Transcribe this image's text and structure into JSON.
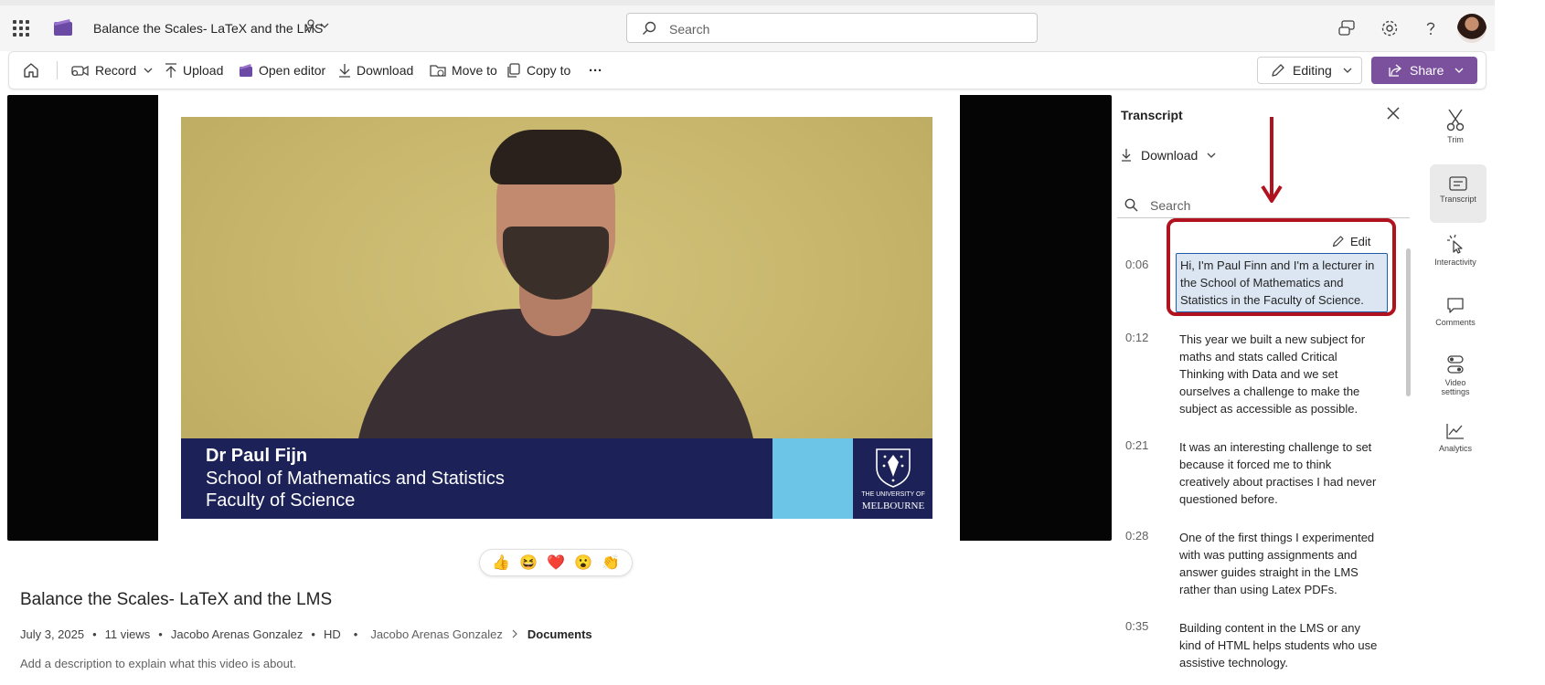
{
  "header": {
    "doc_title": "Balance the Scales- LaTeX and the LMS",
    "search_placeholder": "Search"
  },
  "toolbar": {
    "record": "Record",
    "upload": "Upload",
    "open_editor": "Open editor",
    "download": "Download",
    "move_to": "Move to",
    "copy_to": "Copy to",
    "more": "···",
    "editing": "Editing",
    "share": "Share"
  },
  "video": {
    "lower_third": {
      "name": "Dr Paul Fijn",
      "line2": "School of Mathematics and Statistics",
      "line3": "Faculty of Science",
      "logo_small": "THE UNIVERSITY OF",
      "logo_big": "MELBOURNE"
    },
    "reactions": [
      "👍",
      "😆",
      "❤️",
      "😮",
      "👏"
    ]
  },
  "details": {
    "title": "Balance the Scales- LaTeX and the LMS",
    "date": "July 3, 2025",
    "views": "11 views",
    "owner": "Jacobo Arenas Gonzalez",
    "quality": "HD",
    "path_owner": "Jacobo Arenas Gonzalez",
    "path_folder": "Documents",
    "description_placeholder": "Add a description to explain what this video is about."
  },
  "transcript": {
    "title": "Transcript",
    "download": "Download",
    "search_placeholder": "Search",
    "edit": "Edit",
    "entries": [
      {
        "time": "0:06",
        "text": "Hi, I'm Paul Finn and I'm a lecturer in the School of Mathematics and Statistics in the Faculty of Science."
      },
      {
        "time": "0:12",
        "text": "This year we built a new subject for maths and stats called Critical Thinking with Data and we set ourselves a challenge to make the subject as accessible as possible."
      },
      {
        "time": "0:21",
        "text": "It was an interesting challenge to set because it forced me to think creatively about practises I had never questioned before."
      },
      {
        "time": "0:28",
        "text": "One of the first things I experimented with was putting assignments and answer guides straight in the LMS rather than using Latex PDFs."
      },
      {
        "time": "0:35",
        "text": "Building content in the LMS or any kind of HTML helps students who use assistive technology."
      }
    ]
  },
  "rail": {
    "trim": "Trim",
    "transcript": "Transcript",
    "interactivity": "Interactivity",
    "comments": "Comments",
    "video_settings_1": "Video",
    "video_settings_2": "settings",
    "analytics": "Analytics"
  },
  "colors": {
    "accent": "#7b519d",
    "annotation": "#b0121f",
    "highlight": "#dbe6f2"
  }
}
